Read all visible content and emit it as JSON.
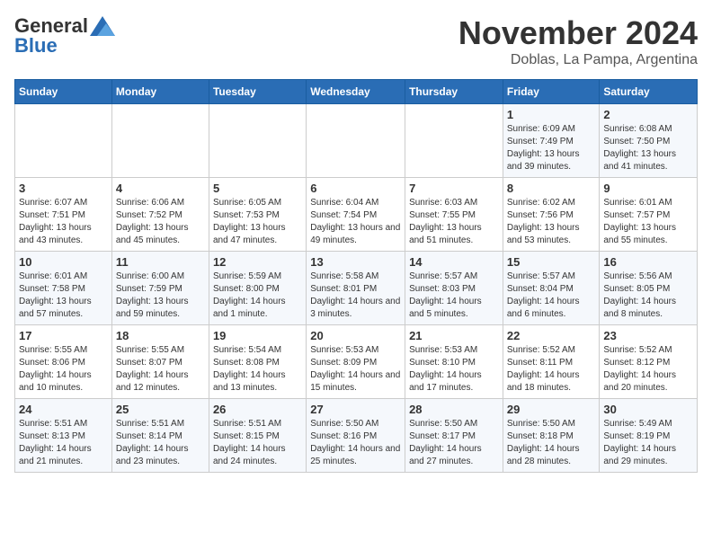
{
  "header": {
    "logo_general": "General",
    "logo_blue": "Blue",
    "month_title": "November 2024",
    "subtitle": "Doblas, La Pampa, Argentina"
  },
  "weekdays": [
    "Sunday",
    "Monday",
    "Tuesday",
    "Wednesday",
    "Thursday",
    "Friday",
    "Saturday"
  ],
  "weeks": [
    [
      {
        "day": "",
        "sunrise": "",
        "sunset": "",
        "daylight": "",
        "empty": true
      },
      {
        "day": "",
        "sunrise": "",
        "sunset": "",
        "daylight": "",
        "empty": true
      },
      {
        "day": "",
        "sunrise": "",
        "sunset": "",
        "daylight": "",
        "empty": true
      },
      {
        "day": "",
        "sunrise": "",
        "sunset": "",
        "daylight": "",
        "empty": true
      },
      {
        "day": "",
        "sunrise": "",
        "sunset": "",
        "daylight": "",
        "empty": true
      },
      {
        "day": "1",
        "sunrise": "Sunrise: 6:09 AM",
        "sunset": "Sunset: 7:49 PM",
        "daylight": "Daylight: 13 hours and 39 minutes."
      },
      {
        "day": "2",
        "sunrise": "Sunrise: 6:08 AM",
        "sunset": "Sunset: 7:50 PM",
        "daylight": "Daylight: 13 hours and 41 minutes."
      }
    ],
    [
      {
        "day": "3",
        "sunrise": "Sunrise: 6:07 AM",
        "sunset": "Sunset: 7:51 PM",
        "daylight": "Daylight: 13 hours and 43 minutes."
      },
      {
        "day": "4",
        "sunrise": "Sunrise: 6:06 AM",
        "sunset": "Sunset: 7:52 PM",
        "daylight": "Daylight: 13 hours and 45 minutes."
      },
      {
        "day": "5",
        "sunrise": "Sunrise: 6:05 AM",
        "sunset": "Sunset: 7:53 PM",
        "daylight": "Daylight: 13 hours and 47 minutes."
      },
      {
        "day": "6",
        "sunrise": "Sunrise: 6:04 AM",
        "sunset": "Sunset: 7:54 PM",
        "daylight": "Daylight: 13 hours and 49 minutes."
      },
      {
        "day": "7",
        "sunrise": "Sunrise: 6:03 AM",
        "sunset": "Sunset: 7:55 PM",
        "daylight": "Daylight: 13 hours and 51 minutes."
      },
      {
        "day": "8",
        "sunrise": "Sunrise: 6:02 AM",
        "sunset": "Sunset: 7:56 PM",
        "daylight": "Daylight: 13 hours and 53 minutes."
      },
      {
        "day": "9",
        "sunrise": "Sunrise: 6:01 AM",
        "sunset": "Sunset: 7:57 PM",
        "daylight": "Daylight: 13 hours and 55 minutes."
      }
    ],
    [
      {
        "day": "10",
        "sunrise": "Sunrise: 6:01 AM",
        "sunset": "Sunset: 7:58 PM",
        "daylight": "Daylight: 13 hours and 57 minutes."
      },
      {
        "day": "11",
        "sunrise": "Sunrise: 6:00 AM",
        "sunset": "Sunset: 7:59 PM",
        "daylight": "Daylight: 13 hours and 59 minutes."
      },
      {
        "day": "12",
        "sunrise": "Sunrise: 5:59 AM",
        "sunset": "Sunset: 8:00 PM",
        "daylight": "Daylight: 14 hours and 1 minute."
      },
      {
        "day": "13",
        "sunrise": "Sunrise: 5:58 AM",
        "sunset": "Sunset: 8:01 PM",
        "daylight": "Daylight: 14 hours and 3 minutes."
      },
      {
        "day": "14",
        "sunrise": "Sunrise: 5:57 AM",
        "sunset": "Sunset: 8:03 PM",
        "daylight": "Daylight: 14 hours and 5 minutes."
      },
      {
        "day": "15",
        "sunrise": "Sunrise: 5:57 AM",
        "sunset": "Sunset: 8:04 PM",
        "daylight": "Daylight: 14 hours and 6 minutes."
      },
      {
        "day": "16",
        "sunrise": "Sunrise: 5:56 AM",
        "sunset": "Sunset: 8:05 PM",
        "daylight": "Daylight: 14 hours and 8 minutes."
      }
    ],
    [
      {
        "day": "17",
        "sunrise": "Sunrise: 5:55 AM",
        "sunset": "Sunset: 8:06 PM",
        "daylight": "Daylight: 14 hours and 10 minutes."
      },
      {
        "day": "18",
        "sunrise": "Sunrise: 5:55 AM",
        "sunset": "Sunset: 8:07 PM",
        "daylight": "Daylight: 14 hours and 12 minutes."
      },
      {
        "day": "19",
        "sunrise": "Sunrise: 5:54 AM",
        "sunset": "Sunset: 8:08 PM",
        "daylight": "Daylight: 14 hours and 13 minutes."
      },
      {
        "day": "20",
        "sunrise": "Sunrise: 5:53 AM",
        "sunset": "Sunset: 8:09 PM",
        "daylight": "Daylight: 14 hours and 15 minutes."
      },
      {
        "day": "21",
        "sunrise": "Sunrise: 5:53 AM",
        "sunset": "Sunset: 8:10 PM",
        "daylight": "Daylight: 14 hours and 17 minutes."
      },
      {
        "day": "22",
        "sunrise": "Sunrise: 5:52 AM",
        "sunset": "Sunset: 8:11 PM",
        "daylight": "Daylight: 14 hours and 18 minutes."
      },
      {
        "day": "23",
        "sunrise": "Sunrise: 5:52 AM",
        "sunset": "Sunset: 8:12 PM",
        "daylight": "Daylight: 14 hours and 20 minutes."
      }
    ],
    [
      {
        "day": "24",
        "sunrise": "Sunrise: 5:51 AM",
        "sunset": "Sunset: 8:13 PM",
        "daylight": "Daylight: 14 hours and 21 minutes."
      },
      {
        "day": "25",
        "sunrise": "Sunrise: 5:51 AM",
        "sunset": "Sunset: 8:14 PM",
        "daylight": "Daylight: 14 hours and 23 minutes."
      },
      {
        "day": "26",
        "sunrise": "Sunrise: 5:51 AM",
        "sunset": "Sunset: 8:15 PM",
        "daylight": "Daylight: 14 hours and 24 minutes."
      },
      {
        "day": "27",
        "sunrise": "Sunrise: 5:50 AM",
        "sunset": "Sunset: 8:16 PM",
        "daylight": "Daylight: 14 hours and 25 minutes."
      },
      {
        "day": "28",
        "sunrise": "Sunrise: 5:50 AM",
        "sunset": "Sunset: 8:17 PM",
        "daylight": "Daylight: 14 hours and 27 minutes."
      },
      {
        "day": "29",
        "sunrise": "Sunrise: 5:50 AM",
        "sunset": "Sunset: 8:18 PM",
        "daylight": "Daylight: 14 hours and 28 minutes."
      },
      {
        "day": "30",
        "sunrise": "Sunrise: 5:49 AM",
        "sunset": "Sunset: 8:19 PM",
        "daylight": "Daylight: 14 hours and 29 minutes."
      }
    ]
  ]
}
